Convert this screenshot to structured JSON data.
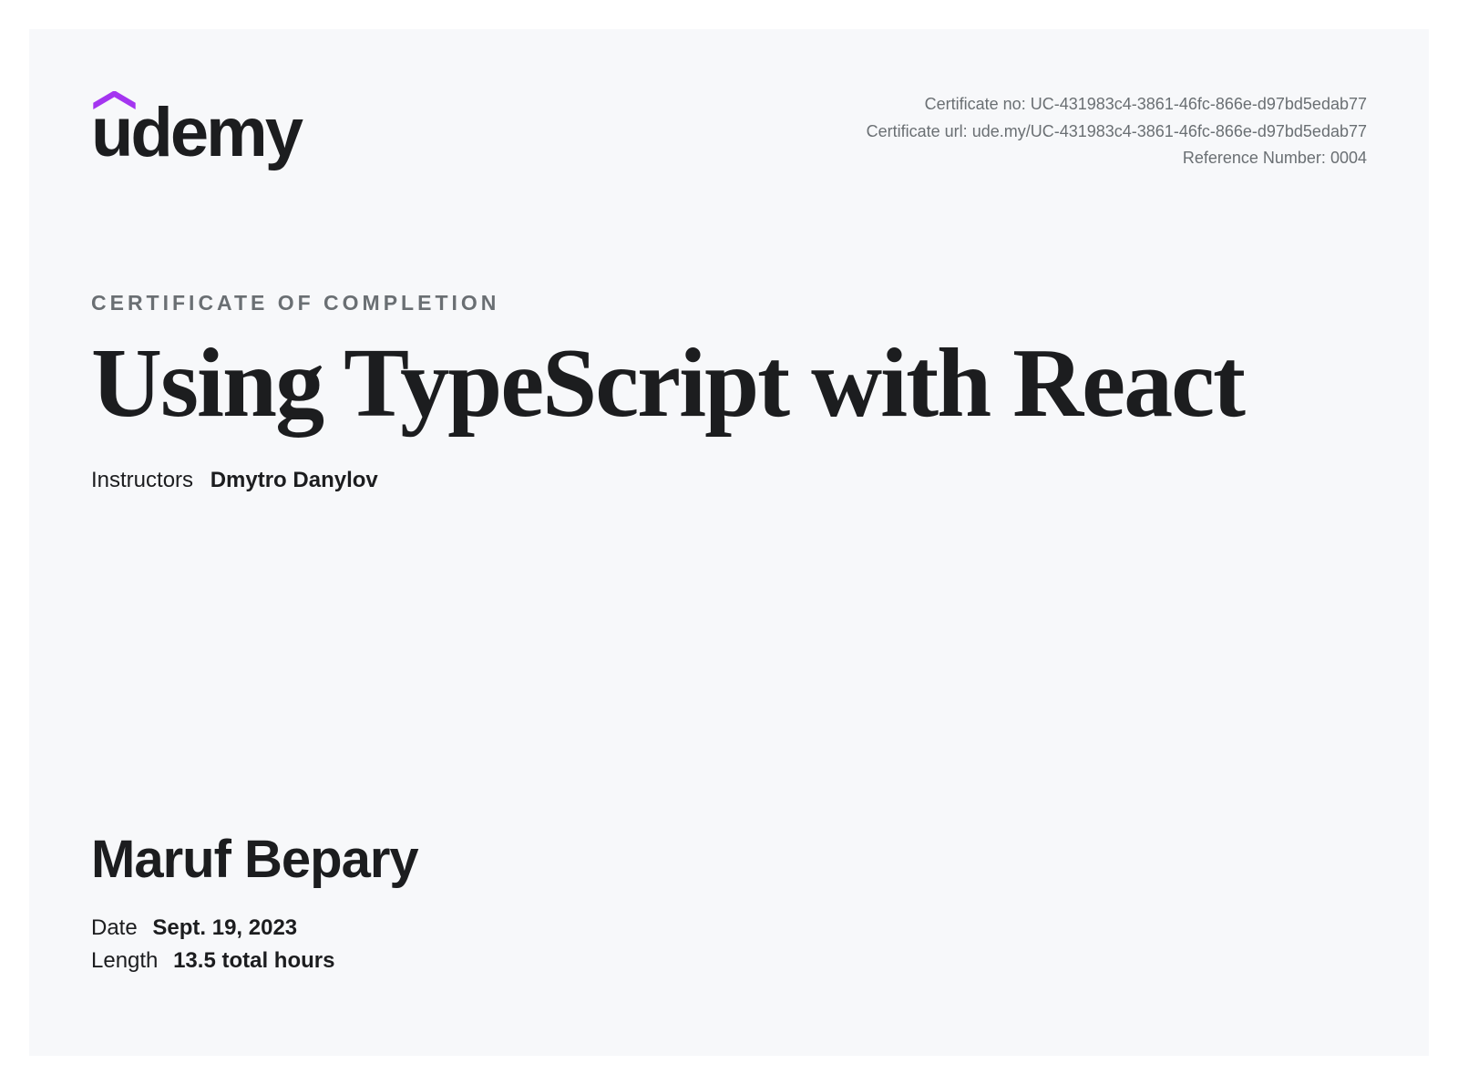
{
  "brand": {
    "name": "udemy"
  },
  "meta": {
    "cert_no_label": "Certificate no:",
    "cert_no_value": "UC-431983c4-3861-46fc-866e-d97bd5edab77",
    "cert_url_label": "Certificate url:",
    "cert_url_value": "ude.my/UC-431983c4-3861-46fc-866e-d97bd5edab77",
    "ref_no_label": "Reference Number:",
    "ref_no_value": "0004"
  },
  "heading": "CERTIFICATE OF COMPLETION",
  "course_title": "Using TypeScript with React",
  "instructors": {
    "label": "Instructors",
    "name": "Dmytro Danylov"
  },
  "recipient": "Maruf Bepary",
  "details": {
    "date_label": "Date",
    "date_value": "Sept. 19, 2023",
    "length_label": "Length",
    "length_value": "13.5 total hours"
  }
}
